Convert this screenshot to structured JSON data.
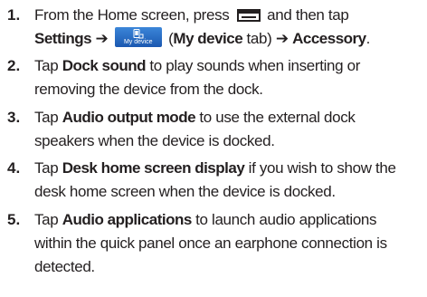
{
  "steps": [
    {
      "number": "1.",
      "line1_pre": "From the Home screen, press",
      "line1_post": "and then tap",
      "settings": "Settings",
      "arrow1": "➔",
      "icon_label": "My device",
      "tab_open": "(",
      "tab_bold": "My device",
      "tab_close": "tab)",
      "arrow2": "➔",
      "accessory": "Accessory",
      "period": "."
    },
    {
      "number": "2.",
      "pre": "Tap",
      "bold": "Dock sound",
      "line1_rest": "to play sounds when inserting or",
      "line2": "removing the device from the dock."
    },
    {
      "number": "3.",
      "pre": "Tap",
      "bold": "Audio output mode",
      "line1_rest": "to use the external dock",
      "line2": "speakers when the device is docked."
    },
    {
      "number": "4.",
      "pre": "Tap",
      "bold": "Desk home screen display",
      "line1_rest": "if you wish to show the",
      "line2": "desk home screen when the device is docked."
    },
    {
      "number": "5.",
      "pre": "Tap",
      "bold": "Audio applications",
      "line1_rest": "to launch audio applications",
      "line2": "within the quick panel once an earphone connection is",
      "line3": "detected."
    }
  ]
}
